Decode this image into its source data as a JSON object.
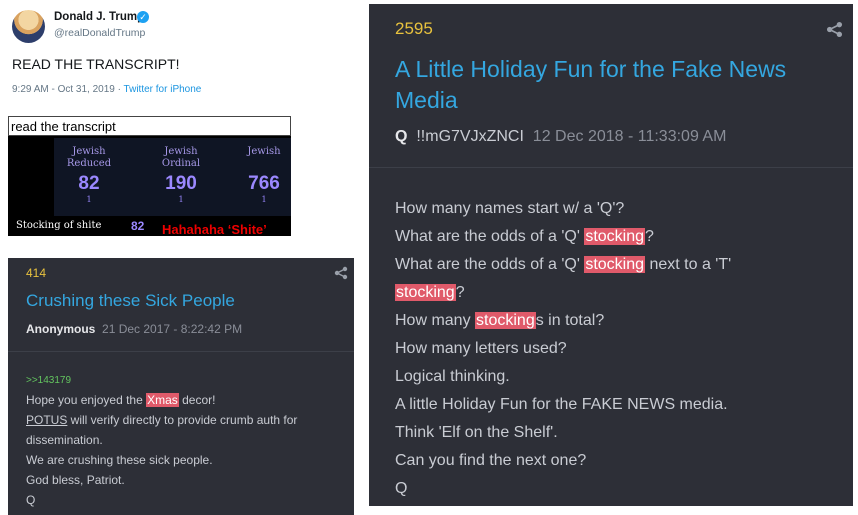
{
  "tweet": {
    "name": "Donald J. Trump",
    "handle": "@realDonaldTrump",
    "text": "READ THE TRANSCRIPT!",
    "meta_time": "9:29 AM - Oct 31, 2019 · ",
    "meta_source": "Twitter for iPhone",
    "verified_icon": "✓"
  },
  "transcript": {
    "bar_text": "read the transcript",
    "columns": [
      {
        "label": "Jewish\nReduced",
        "value": "82",
        "sub": "1"
      },
      {
        "label": "Jewish\nOrdinal",
        "value": "190",
        "sub": "1"
      },
      {
        "label": "Jewish",
        "value": "766",
        "sub": "1"
      }
    ],
    "stocking_label": "Stocking of shite",
    "stocking_value": "82",
    "caption": "Hahahaha  ‘Shite’"
  },
  "post414": {
    "number": "414",
    "title": "Crushing these Sick People",
    "author": "Anonymous",
    "date": "21 Dec 2017 - 8:22:42 PM",
    "reply_ref": ">>143179",
    "l1_pre": "Hope you enjoyed the ",
    "l1_hl": "Xmas",
    "l1_post": " decor!",
    "l2_ul": "POTUS",
    "l2_post": " will verify directly to provide crumb auth for",
    "l3": "dissemination.",
    "l4": "We are crushing these sick people.",
    "l5": "God bless, Patriot.",
    "l6": "Q"
  },
  "post2595": {
    "number": "2595",
    "title_line1": "A Little Holiday Fun for the Fake News",
    "title_line2": "Media",
    "author": "Q",
    "trip": "!!mG7VJxZNCI",
    "date": "12 Dec 2018 - 11:33:09 AM",
    "l1": "How many names start w/ a 'Q'?",
    "l2_pre": "What are the odds of a 'Q' ",
    "l2_hl": "stocking",
    "l2_post": "?",
    "l3_pre": "What are the odds of a 'Q' ",
    "l3_hl": "stocking",
    "l3_post": " next to a 'T'",
    "l4_hl": "stocking",
    "l4_post": "?",
    "l5_pre": "How many ",
    "l5_hl": "stocking",
    "l5_post": "s in total?",
    "l6": "How many letters used?",
    "l7": "Logical thinking.",
    "l8": "A little Holiday Fun for the FAKE NEWS media.",
    "l9": "Think 'Elf on the Shelf'.",
    "l10": "Can you find the next one?",
    "l11": "Q"
  }
}
